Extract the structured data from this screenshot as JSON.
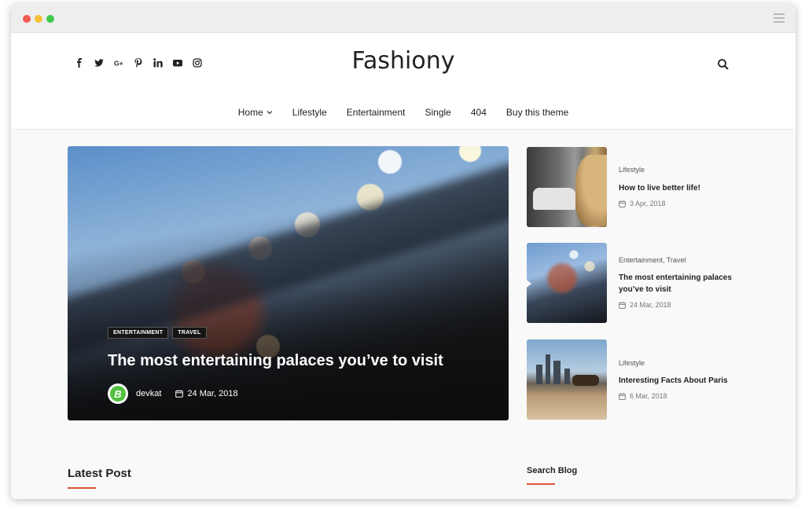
{
  "site": {
    "logo": "Fashiony",
    "nav": [
      {
        "label": "Home",
        "has_dropdown": true
      },
      {
        "label": "Lifestyle"
      },
      {
        "label": "Entertainment"
      },
      {
        "label": "Single"
      },
      {
        "label": "404"
      },
      {
        "label": "Buy this theme"
      }
    ],
    "socials": [
      "facebook-icon",
      "twitter-icon",
      "google-plus-icon",
      "pinterest-icon",
      "linkedin-icon",
      "youtube-icon",
      "instagram-icon"
    ]
  },
  "hero": {
    "tags": [
      "ENTERTAINMENT",
      "TRAVEL"
    ],
    "title": "The most entertaining palaces you’ve to visit",
    "author": "devkat",
    "avatar_letter": "B",
    "date": "24 Mar, 2018"
  },
  "side_posts": [
    {
      "category": "Lifestyle",
      "title": "How to live better life!",
      "date": "3 Apr, 2018"
    },
    {
      "category": "Entertainment, Travel",
      "title": "The most entertaining palaces you’ve to visit",
      "date": "24 Mar, 2018"
    },
    {
      "category": "Lifestyle",
      "title": "Interesting Facts About Paris",
      "date": "6 Mar, 2018"
    }
  ],
  "sections": {
    "latest": "Latest Post",
    "search_widget": "Search Blog"
  },
  "colors": {
    "accent": "#e3513a",
    "avatar_green": "#53c140"
  }
}
